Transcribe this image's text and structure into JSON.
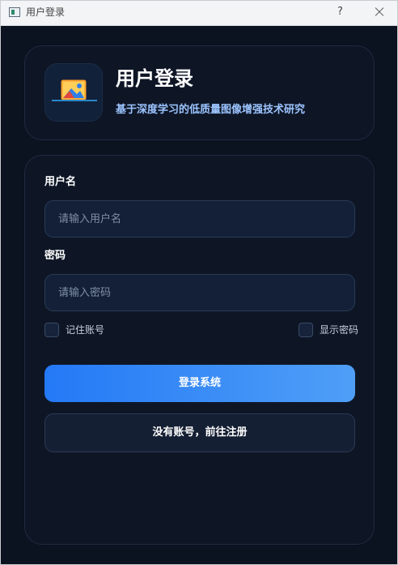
{
  "window": {
    "title": "用户登录",
    "help_glyph": "?"
  },
  "header": {
    "title": "用户登录",
    "subtitle": "基于深度学习的低质量图像增强技术研究",
    "logo_icon": "image-landscape-icon"
  },
  "form": {
    "username": {
      "label": "用户名",
      "placeholder": "请输入用户名",
      "value": ""
    },
    "password": {
      "label": "密码",
      "placeholder": "请输入密码",
      "value": ""
    },
    "remember": {
      "label": "记住账号",
      "checked": false
    },
    "show_password": {
      "label": "显示密码",
      "checked": false
    },
    "login_button": "登录系统",
    "register_button": "没有账号，前往注册"
  },
  "colors": {
    "background": "#0b1220",
    "card": "#0e1626",
    "accent_start": "#2479f6",
    "accent_end": "#4f9ff7",
    "subtitle": "#9cc4ff"
  }
}
